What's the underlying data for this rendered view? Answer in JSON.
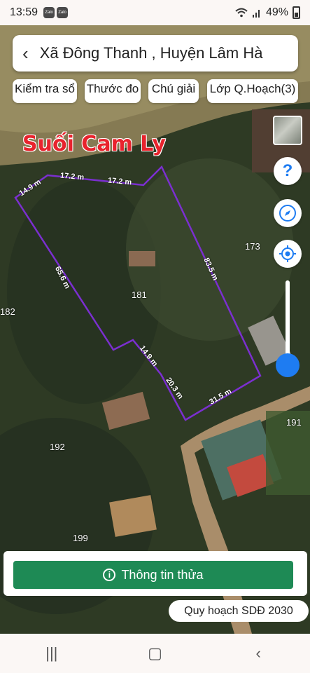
{
  "status": {
    "time": "13:59",
    "zalo1": "Zalo",
    "zalo2": "Zalo",
    "battery": "49%"
  },
  "header": {
    "title": "Xã Đông Thanh , Huyện Lâm Hà"
  },
  "chips": [
    {
      "label": "Kiểm tra sổ"
    },
    {
      "label": "Thước đo"
    },
    {
      "label": "Chú giải"
    },
    {
      "label": "Lớp Q.Hoạch(3)"
    }
  ],
  "map": {
    "stream_label": "Suối Cam Ly",
    "parcel_numbers": {
      "p173": "173",
      "p181": "181",
      "p182": "182",
      "p191": "191",
      "p192": "192",
      "p199": "199"
    },
    "measurements": {
      "m1": "14.9 m",
      "m2": "17.2 m",
      "m3": "17.2 m",
      "m4": "83.5 m",
      "m5": "65.6 m",
      "m6": "14.9 m",
      "m7": "20.3 m",
      "m8": "31.5 m"
    },
    "boundary_color": "#7b2fd0"
  },
  "controls": {
    "help_icon": "question-icon",
    "compass_icon": "compass-icon",
    "locate_icon": "locate-icon"
  },
  "actions": {
    "parcel_info_label": "Thông tin thửa",
    "planning_badge": "Quy hoạch SDĐ 2030"
  },
  "nav": {
    "recent": "|||",
    "home": "▢",
    "back": "‹"
  }
}
